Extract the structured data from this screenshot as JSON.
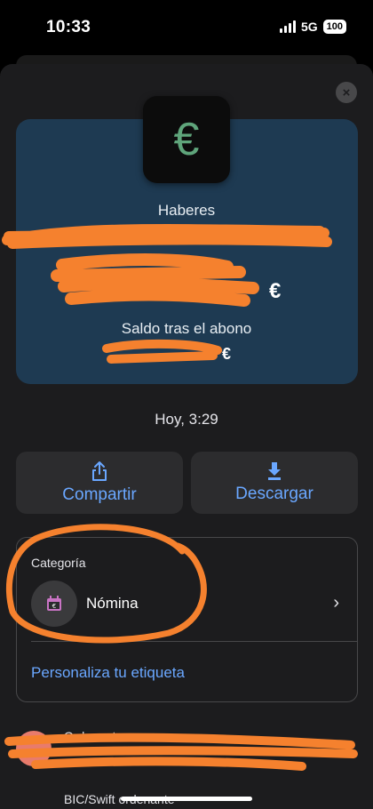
{
  "status_bar": {
    "time": "10:33",
    "network": "5G",
    "battery": "100"
  },
  "close_icon": "×",
  "hero": {
    "currency_symbol": "€",
    "haberes_label": "Haberes",
    "amount_suffix": "€",
    "saldo_label": "Saldo tras el abono",
    "saldo_suffix": "€"
  },
  "date": "Hoy, 3:29",
  "actions": {
    "share_label": "Compartir",
    "download_label": "Descargar"
  },
  "category": {
    "title": "Categoría",
    "name": "Nómina",
    "customize_label": "Personaliza tu etiqueta"
  },
  "details": {
    "ordenante_label": "Ordenante",
    "bic_label": "BIC/Swift ordenante"
  },
  "colors": {
    "accent": "#6aa7ff",
    "hero_bg": "#1e3a52",
    "sheet_bg": "#1c1c1e",
    "highlight": "#f5812e"
  }
}
